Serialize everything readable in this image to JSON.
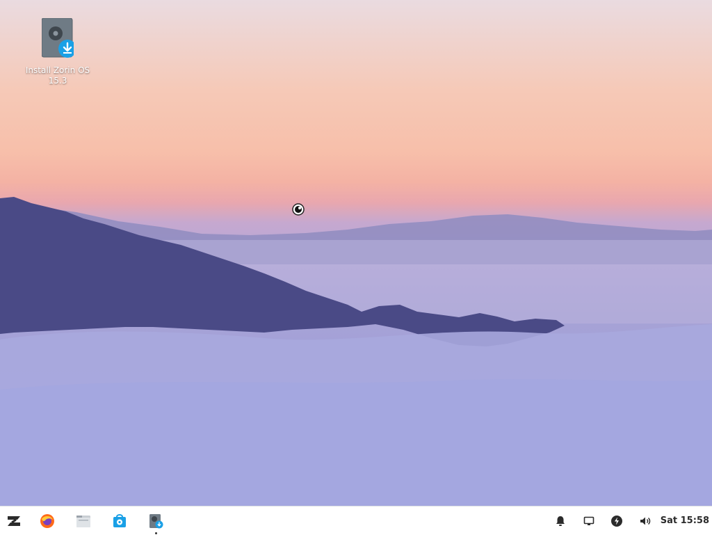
{
  "desktop": {
    "icons": [
      {
        "label": "Install Zorin OS 15.3",
        "icon": "install-disk-icon"
      }
    ]
  },
  "taskbar": {
    "items": [
      {
        "icon": "zorin-menu-icon",
        "running": false
      },
      {
        "icon": "firefox-icon",
        "running": false
      },
      {
        "icon": "files-icon",
        "running": false
      },
      {
        "icon": "software-store-icon",
        "running": false
      },
      {
        "icon": "install-zorin-os-icon",
        "running": true
      }
    ],
    "tray": [
      {
        "icon": "notifications-bell-icon"
      },
      {
        "icon": "display-icon"
      },
      {
        "icon": "power-icon"
      },
      {
        "icon": "volume-icon"
      }
    ],
    "clock": "Sat 15:58"
  },
  "colors": {
    "accent": "#1aa0e6",
    "taskbar_bg": "#ffffff"
  }
}
